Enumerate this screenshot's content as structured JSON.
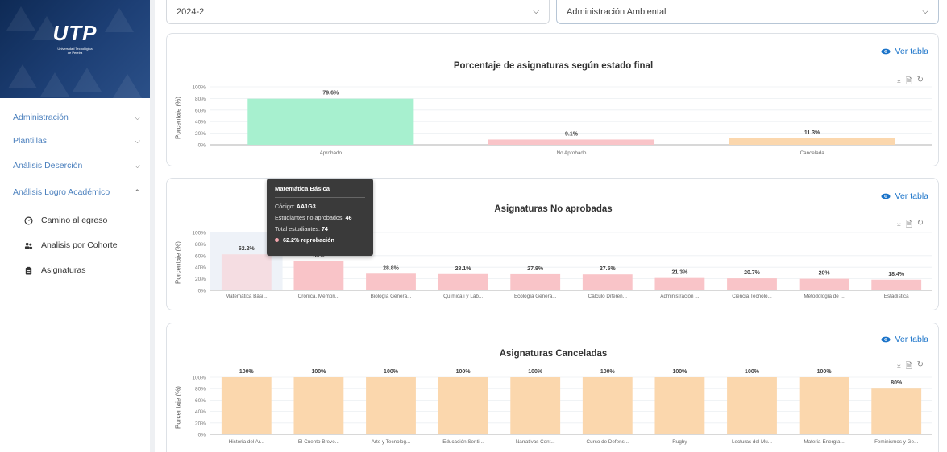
{
  "logo": {
    "mark": "UTP",
    "subtitle_line1": "Universidad Tecnológica",
    "subtitle_line2": "de Pereira"
  },
  "sidebar": {
    "items": [
      {
        "label": "Administración"
      },
      {
        "label": "Plantillas"
      },
      {
        "label": "Análisis Deserción"
      },
      {
        "label": "Análisis Logro Académico"
      }
    ],
    "subitems": [
      {
        "label": "Camino al egreso",
        "icon": "gauge-icon"
      },
      {
        "label": "Analisis por Cohorte",
        "icon": "users-icon"
      },
      {
        "label": "Asignaturas",
        "icon": "clipboard-icon"
      }
    ]
  },
  "filters": {
    "period": "2024-2",
    "program": "Administración Ambiental"
  },
  "actions": {
    "ver_tabla": "Ver tabla"
  },
  "charts_common": {
    "ylabel": "Porcentaje (%)",
    "yticks": [
      "100%",
      "80%",
      "60%",
      "40%",
      "20%",
      "0%"
    ]
  },
  "tooltip": {
    "title": "Matemática Básica",
    "codigo_label": "Código:",
    "codigo_value": "AA1G3",
    "no_aprobados_label": "Estudiantes no aprobados:",
    "no_aprobados_value": "46",
    "total_label": "Total estudiantes:",
    "total_value": "74",
    "reprobacion": "62.2% reprobación"
  },
  "chart_data": [
    {
      "type": "bar",
      "title": "Porcentaje de asignaturas según estado final",
      "ylabel": "Porcentaje (%)",
      "ylim": [
        0,
        100
      ],
      "categories": [
        "Aprobado",
        "No Aprobado",
        "Cancelada"
      ],
      "values": [
        79.6,
        9.1,
        11.3
      ],
      "value_labels": [
        "79.6%",
        "9.1%",
        "11.3%"
      ],
      "colors": [
        "#a7f0cf",
        "#f9c4c8",
        "#fbd7ad"
      ]
    },
    {
      "type": "bar",
      "title": "Asignaturas No aprobadas",
      "ylabel": "Porcentaje (%)",
      "ylim": [
        0,
        100
      ],
      "categories": [
        "Matemática Bási...",
        "Crónica, Memori...",
        "Biología Genera...",
        "Química i y Lab...",
        "Ecología Genera...",
        "Cálculo Diferen...",
        "Administración ...",
        "Ciencia Tecnolo...",
        "Metodología de ...",
        "Estadística"
      ],
      "values": [
        62.2,
        50,
        28.8,
        28.1,
        27.9,
        27.5,
        21.3,
        20.7,
        20,
        18.4
      ],
      "value_labels": [
        "62.2%",
        "50%",
        "28.8%",
        "28.1%",
        "27.9%",
        "27.5%",
        "21.3%",
        "20.7%",
        "20%",
        "18.4%"
      ],
      "color": "#f9c4c8",
      "highlight_color": "#f5dde2"
    },
    {
      "type": "bar",
      "title": "Asignaturas Canceladas",
      "ylabel": "Porcentaje (%)",
      "ylim": [
        0,
        100
      ],
      "categories": [
        "Historia del Ar...",
        "El Cuento Breve...",
        "Arte y Tecnolog...",
        "Educación Senti...",
        "Narrativas Cont...",
        "Curso de Defens...",
        "Rugby",
        "Lecturas del Mu...",
        "Materia-Energía...",
        "Feminismos y Ge..."
      ],
      "values": [
        100,
        100,
        100,
        100,
        100,
        100,
        100,
        100,
        100,
        80
      ],
      "value_labels": [
        "100%",
        "100%",
        "100%",
        "100%",
        "100%",
        "100%",
        "100%",
        "100%",
        "100%",
        "80%"
      ],
      "color": "#fbd7ad"
    }
  ]
}
